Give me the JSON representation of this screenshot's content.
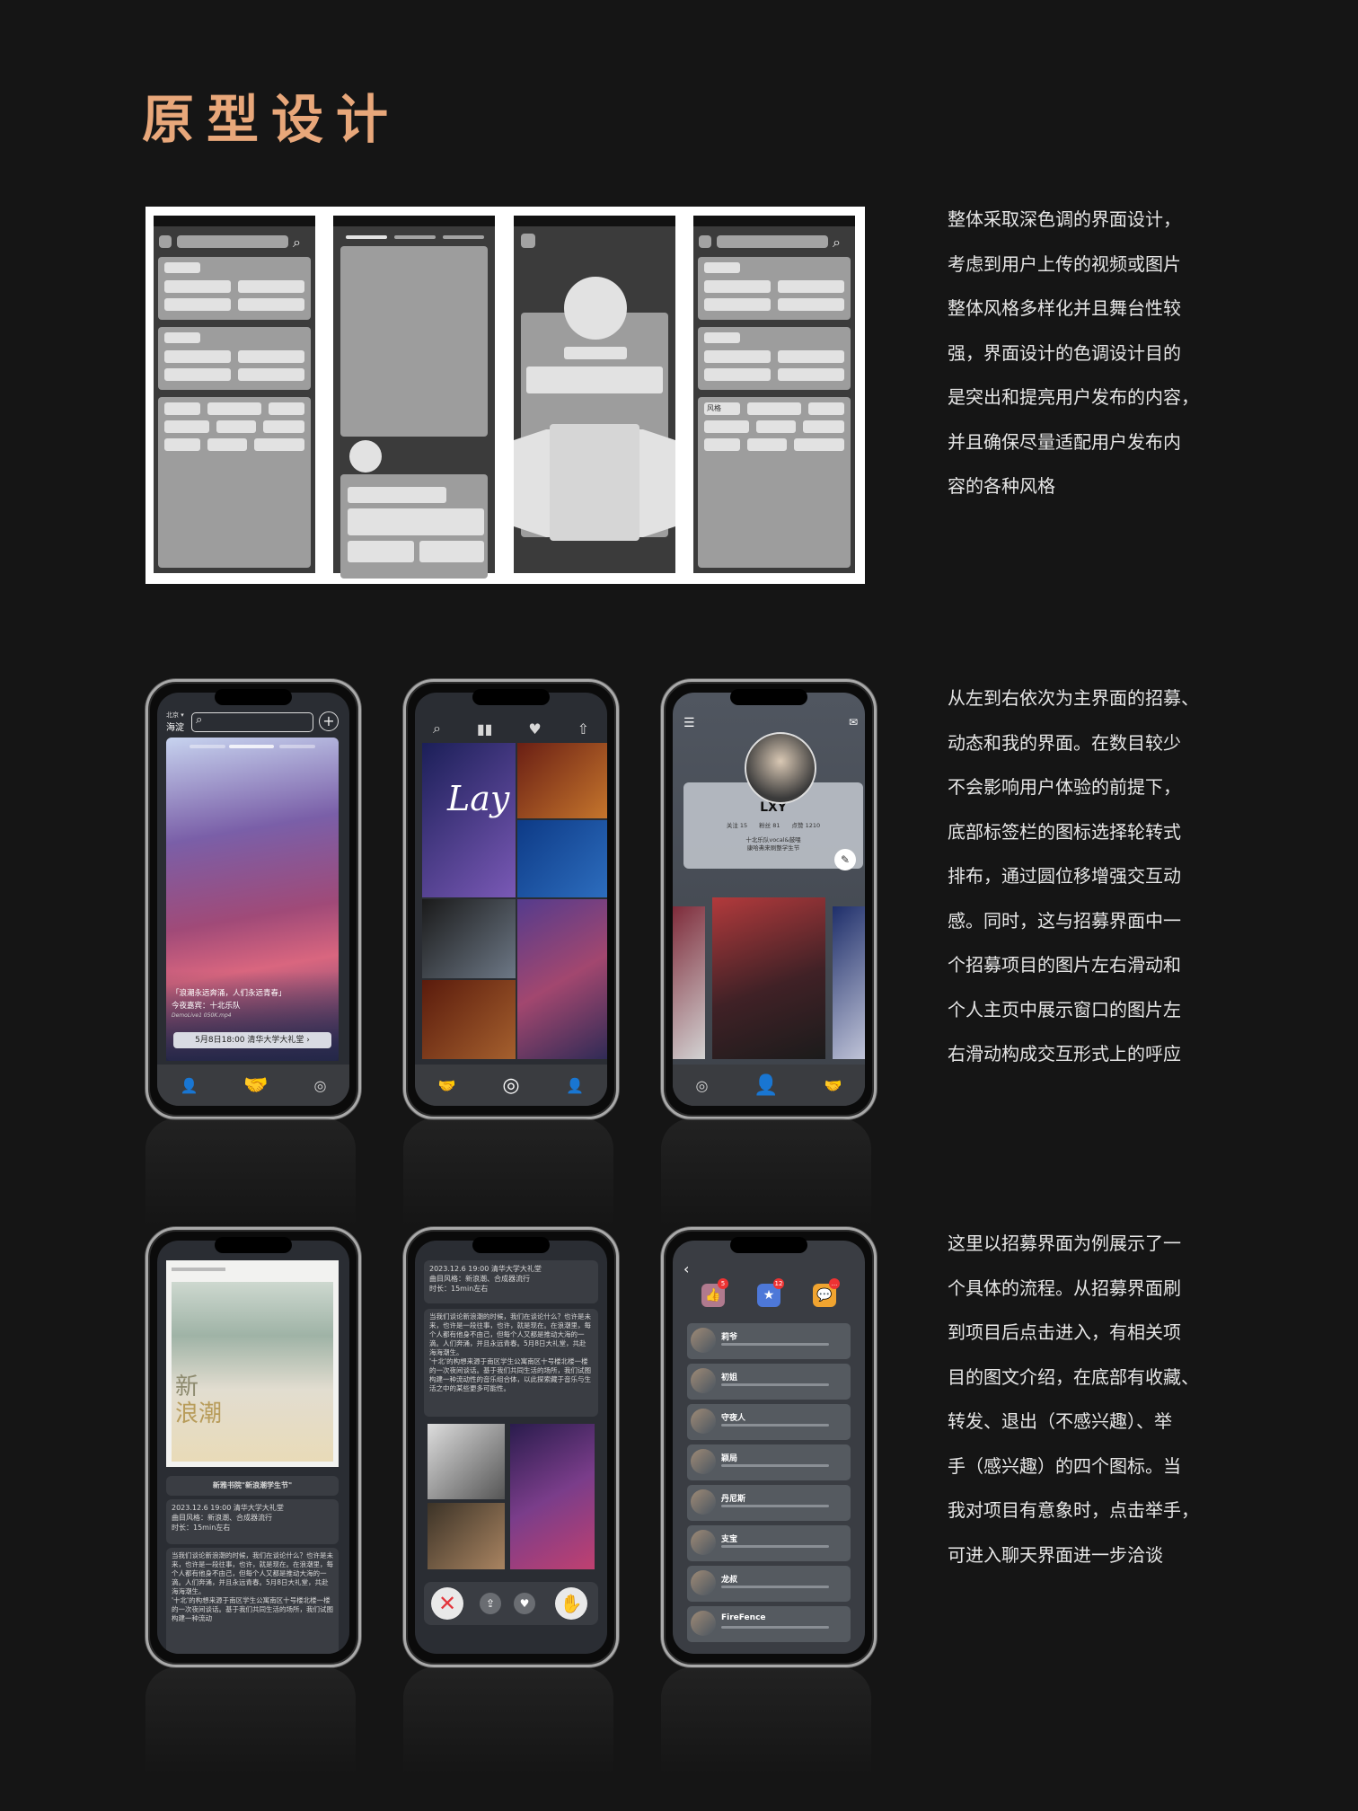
{
  "title": "原型设计",
  "descriptions": [
    {
      "lines": [
        "整体采取深色调的界面设计，",
        "考虑到用户上传的视频或图片",
        "整体风格多样化并且舞台性较",
        "强，界面设计的色调设计目的",
        "是突出和提亮用户发布的内容，",
        "并且确保尽量适配用户发布内",
        "容的各种风格"
      ]
    },
    {
      "lines": [
        "从左到右依次为主界面的招募、",
        "动态和我的界面。在数目较少",
        "不会影响用户体验的前提下，",
        "底部标签栏的图标选择轮转式",
        "排布，通过圆位移增强交互动",
        "感。同时，这与招募界面中一",
        "个招募项目的图片左右滑动和",
        "个人主页中展示窗口的图片左",
        "右滑动构成交互形式上的呼应"
      ]
    },
    {
      "lines": [
        "这里以招募界面为例展示了一",
        "个具体的流程。从招募界面刷",
        "到项目后点击进入，有相关项",
        "目的图文介绍，在底部有收藏、",
        "转发、退出（不感兴趣）、举",
        "手（感兴趣）的四个图标。当",
        "我对项目有意象时，点击举手，",
        "可进入聊天界面进一步洽谈"
      ]
    }
  ],
  "wireframe_tag": "风格",
  "phone1": {
    "city": "北京 ▾",
    "district": "海淀",
    "caption1": "「浪潮永远奔涌，人们永远青春」",
    "caption2": "今夜嘉宾：十北乐队",
    "caption3": "DemoLive1 050K.mp4",
    "event": "5月8日18:00 清华大学大礼堂  ›"
  },
  "phone2": {
    "overlay": "Lay"
  },
  "phone3": {
    "name": "LXY",
    "stats": "关注 15　　粉丝 81　　点赞 1210",
    "bio1": "十北乐队vocal&鼓喂",
    "bio2": "康哈弗来刷整学生节"
  },
  "phone4": {
    "poster_text1": "新",
    "poster_text2": "浪潮",
    "event_title": "新雅书院\"新浪潮学生节\"",
    "info1": "2023.12.6 19:00 清华大学大礼堂",
    "info2": "曲目风格：新浪潮、合成器流行",
    "info3": "时长：15min左右",
    "body": "当我们谈论新浪潮的时候，我们在谈论什么？也许是未来，也许是一段往事，也许，就是现在。在浪潮里，每个人都有他身不由己，但每个人又都是推动大海的一滴。人们奔涌，并且永远青春。5月8日大礼堂，共赴海海潮生。\n'十北'的构想来源于南区学生公寓南区十号楼北楼一楼的一次夜间谈话。基于我们共同生活的场所，我们试图构建一种流动"
  },
  "phone5": {
    "info1": "2023.12.6 19:00 清华大学大礼堂",
    "info2": "曲目风格：新浪潮、合成器流行",
    "info3": "时长：15min左右",
    "body": "当我们谈论新浪潮的时候，我们在谈论什么？也许是未来，也许是一段往事，也许，就是现在。在浪潮里，每个人都有他身不由己，但每个人又都是推动大海的一滴。人们奔涌，并且永远青春。5月8日大礼堂，共赴海海潮生。\n'十北'的构想来源于南区学生公寓南区十号楼北楼一楼的一次夜间谈话。基于我们共同生活的场所，我们试图构建一种流动性的音乐组合体，以此探索藏于音乐与生活之中的某些更多可能性。"
  },
  "phone6": {
    "badges": [
      "5",
      "12",
      "..."
    ],
    "contacts": [
      "莉爷",
      "初姐",
      "守夜人",
      "颖局",
      "丹尼斯",
      "支宝",
      "龙叔",
      "FireFence"
    ]
  }
}
